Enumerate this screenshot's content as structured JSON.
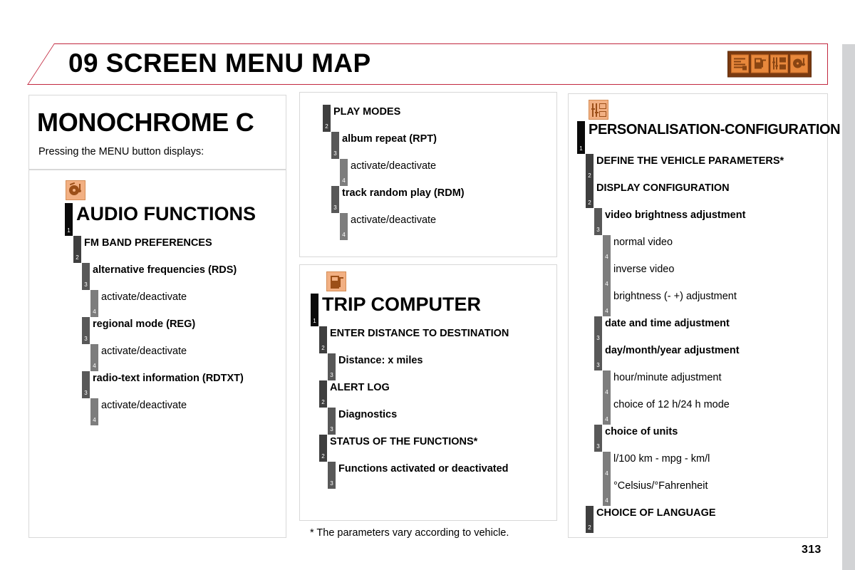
{
  "header": {
    "title": "09 SCREEN MENU MAP",
    "accent_color": "#c2283f",
    "icon_name": "screen-menu-map-icon",
    "icon_box_color": "#7a3a10",
    "icon_tile_color": "#e8883c",
    "tiles": [
      "display-icon",
      "fuel-pump-icon",
      "vehicle-settings-icon",
      "audio-disc-icon"
    ]
  },
  "intro": {
    "title": "MONOCHROME C",
    "subtitle": "Pressing the MENU button displays:"
  },
  "levels": {
    "colors": [
      "#0a0a0a",
      "#3f3f3f",
      "#585858",
      "#7d7d7d"
    ],
    "numbers": [
      "1",
      "2",
      "3",
      "4"
    ]
  },
  "sections": [
    {
      "id": "audio-functions",
      "icon": "audio-disc-icon",
      "title": "AUDIO FUNCTIONS",
      "level": "1",
      "items": [
        {
          "level": "2",
          "label": "FM BAND PREFERENCES"
        },
        {
          "level": "3",
          "label": "alternative frequencies (RDS)"
        },
        {
          "level": "4",
          "label": "activate/deactivate"
        },
        {
          "level": "3",
          "label": "regional mode (REG)"
        },
        {
          "level": "4",
          "label": "activate/deactivate"
        },
        {
          "level": "3",
          "label": "radio-text information (RDTXT)"
        },
        {
          "level": "4",
          "label": "activate/deactivate"
        }
      ]
    },
    {
      "id": "play-modes",
      "icon": null,
      "title": null,
      "level": null,
      "items": [
        {
          "level": "2",
          "label": "PLAY MODES"
        },
        {
          "level": "3",
          "label": "album repeat (RPT)"
        },
        {
          "level": "4",
          "label": "activate/deactivate"
        },
        {
          "level": "3",
          "label": "track random play (RDM)"
        },
        {
          "level": "4",
          "label": "activate/deactivate"
        }
      ]
    },
    {
      "id": "trip-computer",
      "icon": "fuel-pump-icon",
      "title": "TRIP COMPUTER",
      "level": "1",
      "items": [
        {
          "level": "2",
          "label": "ENTER DISTANCE TO DESTINATION"
        },
        {
          "level": "3",
          "label": "Distance: x miles"
        },
        {
          "level": "2",
          "label": "ALERT LOG"
        },
        {
          "level": "3",
          "label": "Diagnostics"
        },
        {
          "level": "2",
          "label": "STATUS OF THE FUNCTIONS*"
        },
        {
          "level": "3",
          "label": "Functions activated or deactivated"
        }
      ]
    },
    {
      "id": "personalisation-configuration",
      "icon": "vehicle-settings-icon",
      "title": "PERSONALISATION-CONFIGURATION",
      "level": "1",
      "items": [
        {
          "level": "2",
          "label": "DEFINE THE VEHICLE PARAMETERS*"
        },
        {
          "level": "2",
          "label": "DISPLAY CONFIGURATION"
        },
        {
          "level": "3",
          "label": "video brightness adjustment"
        },
        {
          "level": "4",
          "label": "normal video"
        },
        {
          "level": "4",
          "label": "inverse video"
        },
        {
          "level": "4",
          "label": "brightness (- +) adjustment"
        },
        {
          "level": "3",
          "label": "date and time adjustment"
        },
        {
          "level": "3",
          "label": "day/month/year adjustment"
        },
        {
          "level": "4",
          "label": "hour/minute adjustment"
        },
        {
          "level": "4",
          "label": "choice of 12 h/24 h mode"
        },
        {
          "level": "3",
          "label": "choice of units"
        },
        {
          "level": "4",
          "label": "l/100 km - mpg - km/l"
        },
        {
          "level": "4",
          "label": "°Celsius/°Fahrenheit"
        },
        {
          "level": "2",
          "label": "CHOICE OF LANGUAGE"
        }
      ]
    }
  ],
  "footnote": "* The parameters vary according to vehicle.",
  "page_number": "313"
}
